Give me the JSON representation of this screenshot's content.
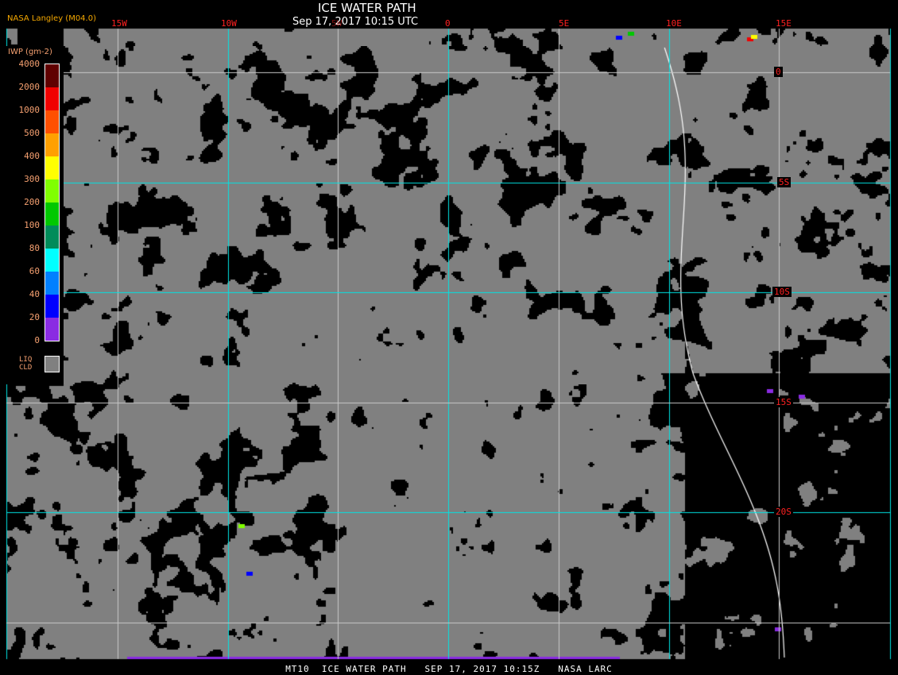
{
  "header": {
    "title": "ICE WATER PATH",
    "datetime": "Sep 17, 2017 10:15 UTC",
    "org": "NASA Langley (M04.0)"
  },
  "map": {
    "longitude_labels": [
      "15W",
      "10W",
      "5W",
      "0",
      "5E",
      "10E",
      "15E"
    ],
    "latitude_labels": [
      "0",
      "5S",
      "10S",
      "15S",
      "20S"
    ],
    "colors": {
      "clear": "#000000",
      "liquid_cloud": "#808080",
      "grid_major": "#00e5e5",
      "grid_minor": "#c8c8c8",
      "coastline": "#ffffff",
      "labels": "#ff2020"
    }
  },
  "legend": {
    "unit": "IWP (gm-2)",
    "levels": [
      "4000",
      "2000",
      "1000",
      "500",
      "400",
      "300",
      "200",
      "100",
      "80",
      "60",
      "40",
      "20",
      "0"
    ],
    "colors": [
      "#600000",
      "#f00000",
      "#ff5000",
      "#ffa000",
      "#ffff00",
      "#80ff00",
      "#00c800",
      "#008c5a",
      "#00ffff",
      "#0080ff",
      "#0000ff",
      "#8a2be2"
    ],
    "liq_label_1": "LIQ",
    "liq_label_2": "CLD",
    "liq_color": "#808080"
  },
  "footer": {
    "caption": "MT10  ICE WATER PATH   SEP 17, 2017 10:15Z   NASA LARC"
  }
}
